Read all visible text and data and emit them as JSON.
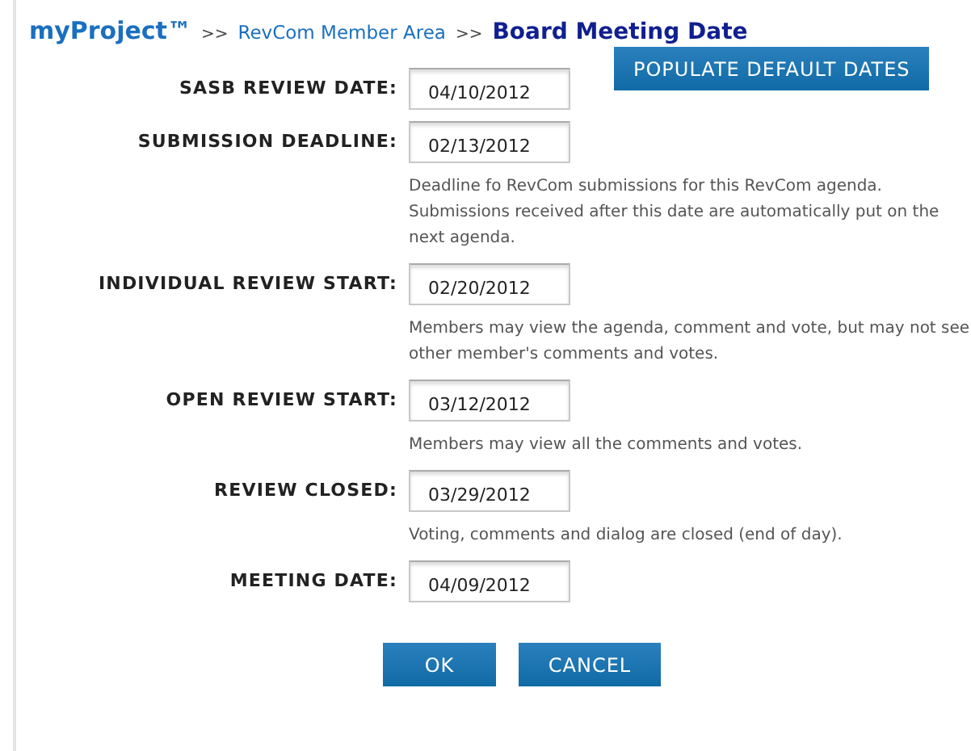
{
  "breadcrumb": {
    "home": "myProject™",
    "separator": ">>",
    "section": "RevCom Member Area",
    "current": "Board Meeting Date"
  },
  "populate_button": "POPULATE DEFAULT DATES",
  "fields": [
    {
      "label": "SASB REVIEW DATE:",
      "value": "04/10/2012"
    },
    {
      "label": "SUBMISSION DEADLINE:",
      "value": "02/13/2012",
      "note": "Deadline fo RevCom submissions for this RevCom agenda. Submissions received after this date are automatically put on the next agenda."
    },
    {
      "label": "INDIVIDUAL REVIEW START:",
      "value": "02/20/2012",
      "note": "Members may view the agenda, comment and vote, but may not see other member's comments and votes."
    },
    {
      "label": "OPEN REVIEW START:",
      "value": "03/12/2012",
      "note": "Members may view all the comments and votes."
    },
    {
      "label": "REVIEW CLOSED:",
      "value": "03/29/2012",
      "note": "Voting, comments and dialog are closed (end of day)."
    },
    {
      "label": "MEETING DATE:",
      "value": "04/09/2012"
    }
  ],
  "buttons": [
    "OK",
    "CANCEL"
  ]
}
